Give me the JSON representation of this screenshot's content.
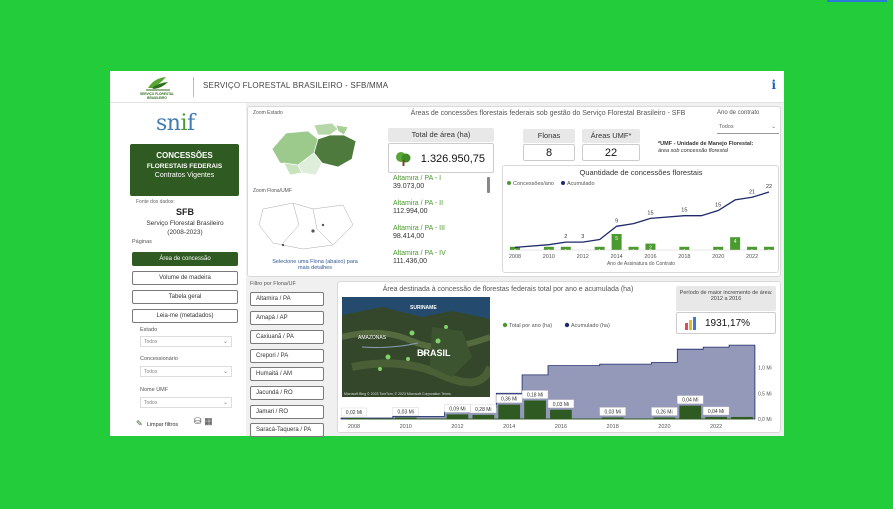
{
  "header": {
    "title": "SERVIÇO FLORESTAL BRASILEIRO - SFB/MMA",
    "logo_text": "SERVIÇO FLORESTAL BRASILEIRO",
    "info": "i"
  },
  "sidebar": {
    "brand": "snif",
    "box": {
      "line1": "CONCESSÕES",
      "line2": "FLORESTAIS FEDERAIS",
      "line3": "Contratos Vigentes"
    },
    "fonte_label": "Fonte dos dados:",
    "fonte_sfb": "SFB",
    "fonte_name": "Serviço Florestal Brasileiro",
    "fonte_period": "(2008-2023)",
    "paginas_label": "Páginas",
    "nav": [
      "Área de concessão",
      "Volume de madeira",
      "Tabela geral",
      "Leia-me (metadados)"
    ],
    "filters": [
      {
        "label": "Estado",
        "value": "Todos"
      },
      {
        "label": "Concessionário",
        "value": "Todos"
      },
      {
        "label": "Nome UMF",
        "value": "Todos"
      }
    ],
    "limpar": "Limpar filtros"
  },
  "top": {
    "zoom_estado": "Zoom Estado",
    "zoom_flona": "Zoom Flona/UMF",
    "map_hint": "Selecione uma Flona (abaixo) para mais detalhes",
    "main_title": "Áreas de concessões florestais federais sob gestão do Serviço Florestal Brasileiro - SFB",
    "ano_label": "Ano de contrato",
    "ano_value": "Todos",
    "total_label": "Total de área (ha)",
    "total_value": "1.326.950,75",
    "flonas_label": "Flonas",
    "flonas_value": "8",
    "umf_label": "Áreas UMF*",
    "umf_value": "22",
    "umf_note_bold": "*UMF - Unidade de Manejo Florestal:",
    "umf_note": "área sob concessão florestal",
    "flona_list": [
      {
        "name": "Altamira / PA - I",
        "value": "39.073,00"
      },
      {
        "name": "Altamira / PA - II",
        "value": "112.994,00"
      },
      {
        "name": "Altamira / PA - III",
        "value": "98.414,00"
      },
      {
        "name": "Altamira / PA - IV",
        "value": "111.436,00"
      }
    ],
    "qty_chart": {
      "title": "Quantidade de concessões florestais",
      "legend": [
        "Concessões/ano",
        "Acumulado"
      ],
      "xlabel": "Ano de Assinatura do Contrato"
    }
  },
  "bottom": {
    "filtro_label": "Filtro por Flona/UF",
    "flona_buttons": [
      "Altamira / PA",
      "Amapá / AP",
      "Caxiuanã / PA",
      "Crepori / PA",
      "Humaitá / AM",
      "Jacundá / RO",
      "Jamari / RO",
      "Saracá-Taquera / PA"
    ],
    "area_title": "Área destinada à concessão de florestas federais total por ano e acumulada (ha)",
    "periodo_title": "Período de maior incremento de área: 2012 a 2016",
    "periodo_value": "1931,17%",
    "legend": [
      "Total por ano (ha)",
      "Acumulado (ha)"
    ],
    "map_labels": [
      "SURINAME",
      "AMAZONAS",
      "BRASIL"
    ],
    "map_credit": "Microsoft Bing  © 2023 TomTom, © 2023 Microsoft Corporation  Terms"
  },
  "colors": {
    "dark_green": "#2f5a22",
    "accent_green": "#4a9a2f",
    "navy": "#1f2a6b",
    "area_fill": "#9499b9"
  },
  "chart_data": [
    {
      "type": "bar",
      "title": "Quantidade de concessões florestais",
      "xlabel": "Ano de Assinatura do Contrato",
      "x": [
        2008,
        2010,
        2011,
        2012,
        2013,
        2014,
        2015,
        2016,
        2018,
        2019,
        2020,
        2021,
        2022,
        2023
      ],
      "series": [
        {
          "name": "Concessões/ano",
          "values": [
            1,
            1,
            1,
            0,
            1,
            5,
            1,
            2,
            1,
            0,
            1,
            4,
            1,
            1
          ]
        },
        {
          "name": "Acumulado",
          "values": [
            1,
            2,
            3,
            3,
            4,
            9,
            10,
            12,
            13,
            13,
            15,
            19,
            20,
            22
          ]
        }
      ],
      "point_labels": [
        {
          "x": 2011,
          "label": "2"
        },
        {
          "x": 2012,
          "label": "3"
        },
        {
          "x": 2014,
          "label": "9"
        },
        {
          "x": 2016,
          "label": "15"
        },
        {
          "x": 2018,
          "label": "15"
        },
        {
          "x": 2020,
          "label": "15"
        },
        {
          "x": 2022,
          "label": "21"
        },
        {
          "x": 2023,
          "label": "22"
        }
      ],
      "xticks": [
        2008,
        2010,
        2012,
        2014,
        2016,
        2018,
        2020,
        2022
      ]
    },
    {
      "type": "area",
      "title": "Área destinada à concessão de florestas federais total por ano e acumulada (ha)",
      "x": [
        2008,
        2009,
        2010,
        2011,
        2012,
        2013,
        2014,
        2015,
        2016,
        2017,
        2018,
        2019,
        2020,
        2021,
        2022,
        2023
      ],
      "series": [
        {
          "name": "Total por ano (ha)",
          "values": [
            0.02,
            0,
            0.03,
            0,
            0.09,
            0.08,
            0.28,
            0.36,
            0.18,
            0,
            0.03,
            0,
            0.03,
            0.26,
            0.04,
            0.04
          ]
        },
        {
          "name": "Acumulado (ha)",
          "values": [
            0.02,
            0.02,
            0.05,
            0.05,
            0.14,
            0.22,
            0.5,
            0.86,
            1.04,
            1.04,
            1.07,
            1.07,
            1.1,
            1.36,
            1.4,
            1.44
          ]
        }
      ],
      "data_labels": [
        "0,02 Mi",
        "0,03 Mi",
        "0,09 Mi",
        "0,28 Mi",
        "0,36 Mi",
        "0,18 Mi",
        "0,03 Mi",
        "0,03 Mi",
        "0,26 Mi",
        "0,04 Mi",
        "0,04 Mi"
      ],
      "xticks": [
        2008,
        2010,
        2012,
        2014,
        2016,
        2018,
        2020,
        2022
      ],
      "yticks": [
        "0,0 Mi",
        "0,5 Mi",
        "1,0 Mi"
      ],
      "ylim": [
        0,
        1.5
      ]
    }
  ]
}
